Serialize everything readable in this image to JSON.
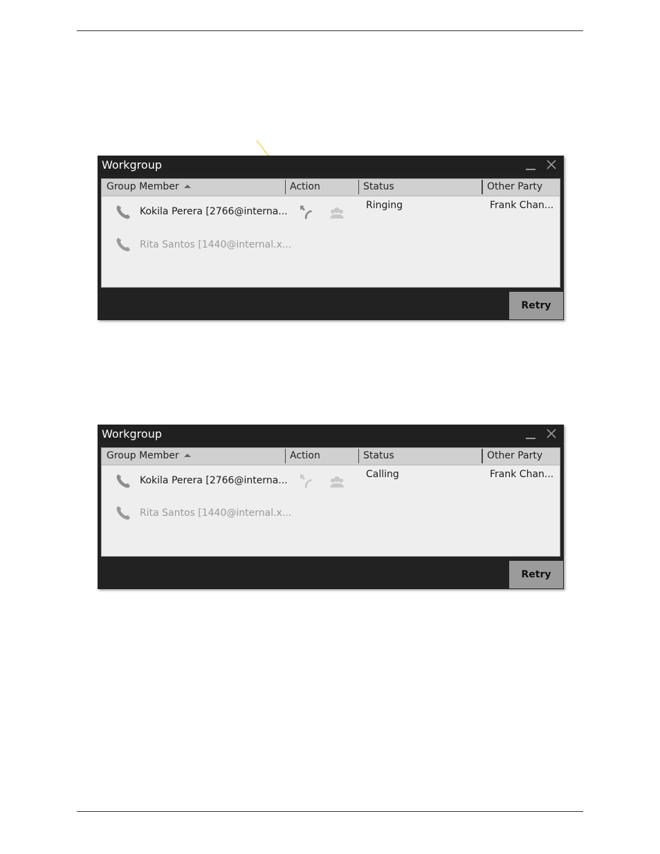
{
  "windows": [
    {
      "title": "Workgroup",
      "columns": {
        "member": "Group Member",
        "action": "Action",
        "status": "Status",
        "other": "Other Party"
      },
      "rows": [
        {
          "name": "Kokila Perera [2766@interna...",
          "status": "Ringing",
          "other_party": "Frank Chan...",
          "pickup_icon": "call-pickup-icon",
          "pickup_enabled": true
        },
        {
          "name": "Rita Santos [1440@internal.x...",
          "status": "",
          "other_party": ""
        }
      ],
      "retry_label": "Retry"
    },
    {
      "title": "Workgroup",
      "columns": {
        "member": "Group Member",
        "action": "Action",
        "status": "Status",
        "other": "Other Party"
      },
      "rows": [
        {
          "name": "Kokila Perera [2766@interna...",
          "status": "Calling",
          "other_party": "Frank Chan...",
          "pickup_icon": "call-pickup-icon",
          "pickup_enabled": false
        },
        {
          "name": "Rita Santos [1440@internal.x...",
          "status": "",
          "other_party": ""
        }
      ],
      "retry_label": "Retry"
    }
  ],
  "colors": {
    "titlebar": "#202020",
    "panel": "#eeeeee",
    "header": "#d0d0d0",
    "retry_button": "#9b9b9b",
    "callout_line": "#f0c000"
  },
  "icons": {
    "phone": "phone-icon",
    "pickup": "call-pickup-icon",
    "conference": "conference-icon",
    "minimize": "minimize-icon",
    "close": "close-icon",
    "sort": "sort-ascending-icon"
  }
}
